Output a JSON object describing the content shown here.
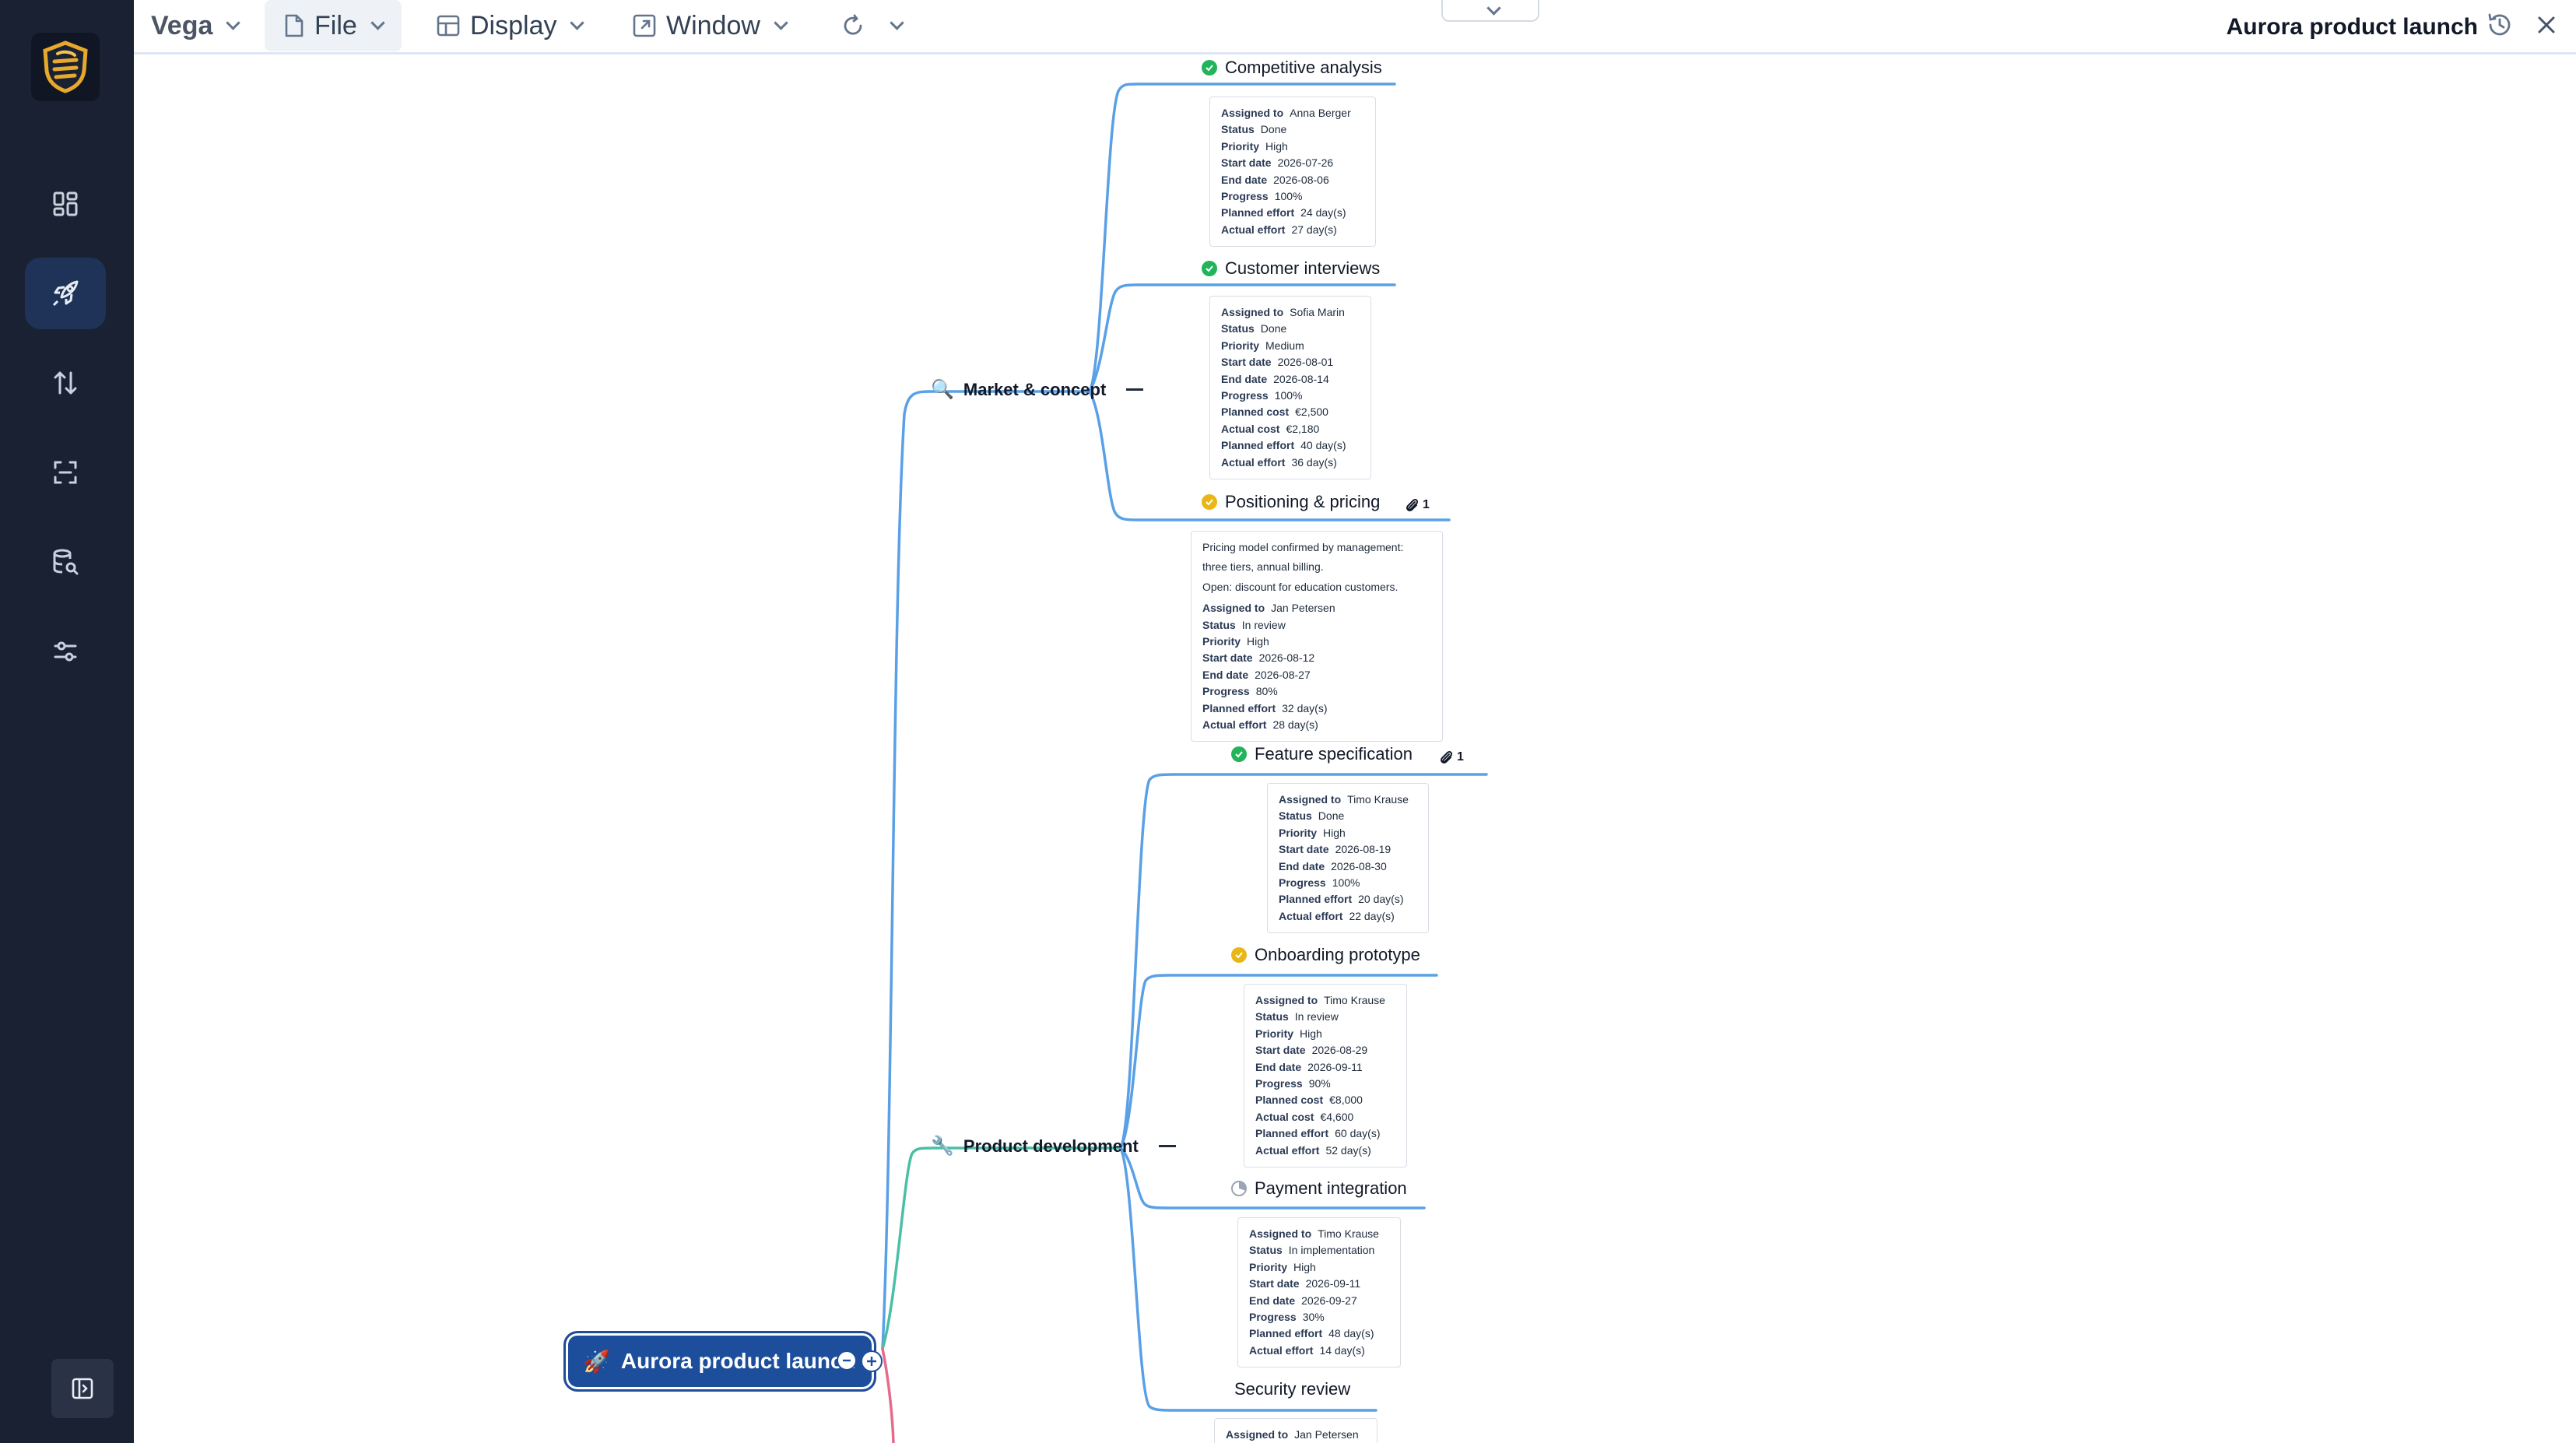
{
  "topbar": {
    "app_name": "Vega",
    "menus": {
      "file": "File",
      "display": "Display",
      "window": "Window"
    },
    "document_title": "Aurora product launch"
  },
  "sidebar": {
    "items": [
      "dashboard",
      "projects",
      "import-export",
      "scan",
      "database-search",
      "settings"
    ],
    "active": "projects"
  },
  "colors": {
    "sidebar_bg": "#1a2133",
    "accent": "#1d4e9b",
    "link_blue": "#5aa0e6",
    "link_teal": "#4bbfa6",
    "link_pink": "#e56b8c",
    "done": "#22b45a",
    "review": "#e8b716"
  },
  "labels": {
    "assigned": "Assigned to",
    "status": "Status",
    "priority": "Priority",
    "start": "Start date",
    "end": "End date",
    "progress": "Progress",
    "planned_cost": "Planned cost",
    "actual_cost": "Actual cost",
    "planned_effort": "Planned effort",
    "actual_effort": "Actual effort"
  },
  "root": {
    "icon": "🚀",
    "label": "Aurora product launch"
  },
  "branches": {
    "market": {
      "icon": "🔍",
      "label": "Market & concept"
    },
    "product": {
      "icon": "🔧",
      "label": "Product development"
    }
  },
  "tasks": {
    "competitive": {
      "title": "Competitive analysis",
      "state": "done",
      "assigned": "Anna Berger",
      "status": "Done",
      "priority": "High",
      "start": "2026-07-26",
      "end": "2026-08-06",
      "progress": "100%",
      "planned_effort": "24 day(s)",
      "actual_effort": "27 day(s)"
    },
    "interviews": {
      "title": "Customer interviews",
      "state": "done",
      "assigned": "Sofia Marin",
      "status": "Done",
      "priority": "Medium",
      "start": "2026-08-01",
      "end": "2026-08-14",
      "progress": "100%",
      "planned_cost": "€2,500",
      "actual_cost": "€2,180",
      "planned_effort": "40 day(s)",
      "actual_effort": "36 day(s)"
    },
    "positioning": {
      "title": "Positioning & pricing",
      "state": "review",
      "attachments": "1",
      "notes": [
        "Pricing model confirmed by management:",
        "three tiers, annual billing.",
        "Open: discount for education customers."
      ],
      "assigned": "Jan Petersen",
      "status": "In review",
      "priority": "High",
      "start": "2026-08-12",
      "end": "2026-08-27",
      "progress": "80%",
      "planned_effort": "32 day(s)",
      "actual_effort": "28 day(s)"
    },
    "feature": {
      "title": "Feature specification",
      "state": "done",
      "attachments": "1",
      "assigned": "Timo Krause",
      "status": "Done",
      "priority": "High",
      "start": "2026-08-19",
      "end": "2026-08-30",
      "progress": "100%",
      "planned_effort": "20 day(s)",
      "actual_effort": "22 day(s)"
    },
    "onboarding": {
      "title": "Onboarding prototype",
      "state": "review",
      "assigned": "Timo Krause",
      "status": "In review",
      "priority": "High",
      "start": "2026-08-29",
      "end": "2026-09-11",
      "progress": "90%",
      "planned_cost": "€8,000",
      "actual_cost": "€4,600",
      "planned_effort": "60 day(s)",
      "actual_effort": "52 day(s)"
    },
    "payment": {
      "title": "Payment integration",
      "state": "in-progress",
      "assigned": "Timo Krause",
      "status": "In implementation",
      "priority": "High",
      "start": "2026-09-11",
      "end": "2026-09-27",
      "progress": "30%",
      "planned_effort": "48 day(s)",
      "actual_effort": "14 day(s)"
    },
    "security": {
      "title": "Security review",
      "state": "none",
      "assigned": "Jan Petersen"
    }
  }
}
